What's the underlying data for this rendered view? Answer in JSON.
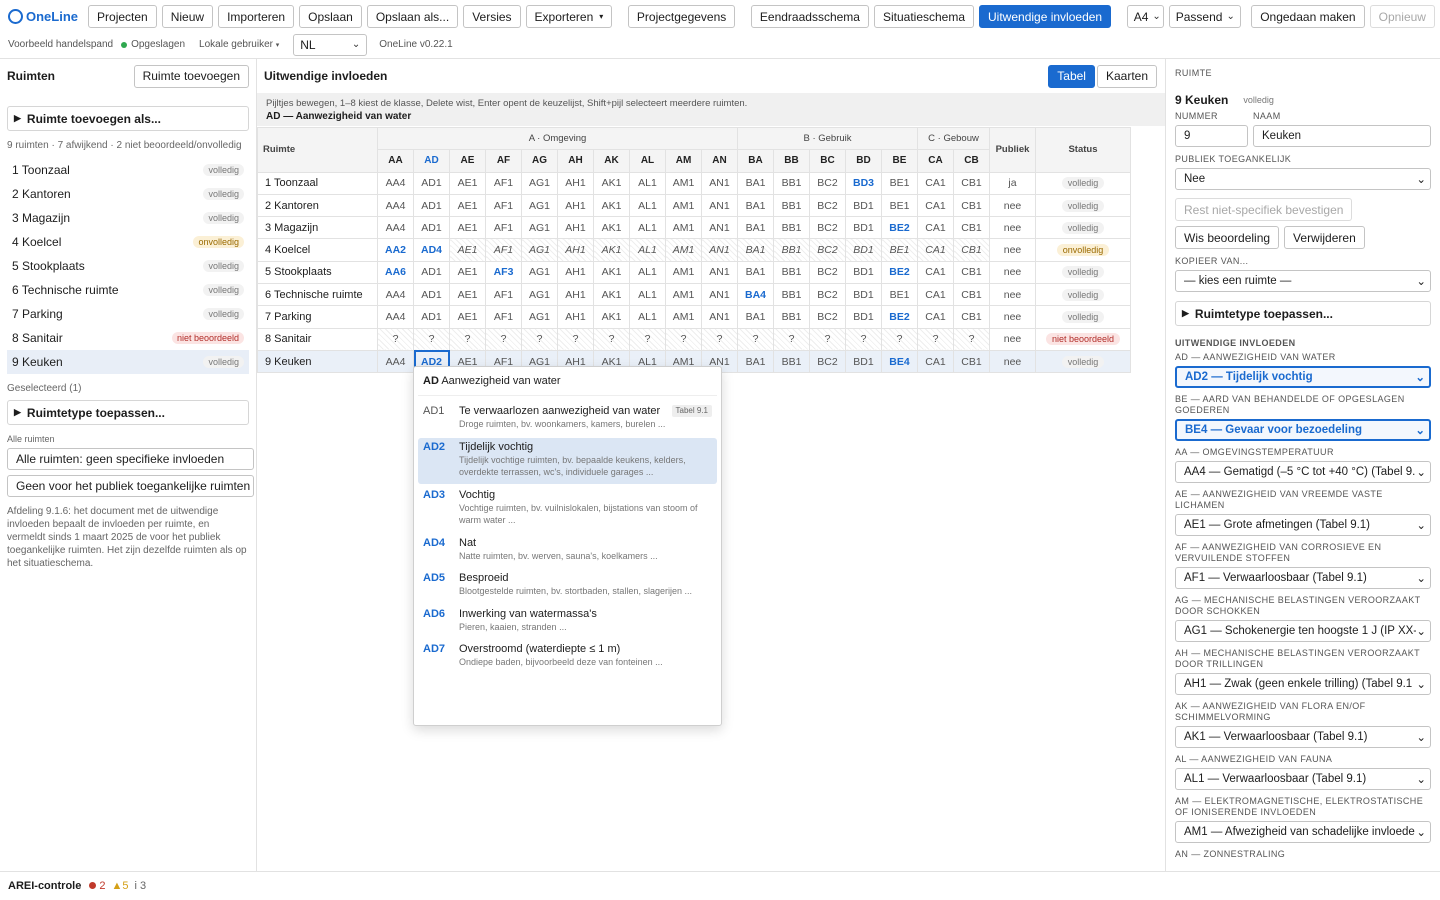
{
  "toolbar": {
    "logo": "OneLine",
    "buttons": [
      "Projecten",
      "Nieuw",
      "Importeren",
      "Opslaan",
      "Opslaan als...",
      "Versies"
    ],
    "export": "Exporteren",
    "project_data": "Projectgegevens",
    "views": [
      "Eendraadsschema",
      "Situatieschema",
      "Uitwendige invloeden"
    ],
    "paper": "A4",
    "fit": "Passend",
    "undo": "Ongedaan maken",
    "redo": "Opnieuw"
  },
  "subbar": {
    "project": "Voorbeeld handelspand",
    "saved": "Opgeslagen",
    "user": "Lokale gebruiker",
    "lang": "NL",
    "version": "OneLine v0.22.1"
  },
  "left": {
    "title": "Ruimten",
    "add_room": "Ruimte toevoegen",
    "add_as": "Ruimte toevoegen als...",
    "summary": "9 ruimten · 7 afwijkend · 2 niet beoordeeld/onvolledig",
    "rooms": [
      {
        "name": "1 Toonzaal",
        "status": "volledig"
      },
      {
        "name": "2 Kantoren",
        "status": "volledig"
      },
      {
        "name": "3 Magazijn",
        "status": "volledig"
      },
      {
        "name": "4 Koelcel",
        "status": "onvolledig"
      },
      {
        "name": "5 Stookplaats",
        "status": "volledig"
      },
      {
        "name": "6 Technische ruimte",
        "status": "volledig"
      },
      {
        "name": "7 Parking",
        "status": "volledig"
      },
      {
        "name": "8 Sanitair",
        "status": "niet beoordeeld"
      },
      {
        "name": "9 Keuken",
        "status": "volledig"
      }
    ],
    "selected_label": "Geselecteerd (1)",
    "apply_type": "Ruimtetype toepassen...",
    "all_rooms_label": "Alle ruimten",
    "all_rooms_btn1": "Alle ruimten: geen specifieke invloeden",
    "all_rooms_btn2": "Geen voor het publiek toegankelijke ruimten",
    "note": "Afdeling 9.1.6: het document met de uitwendige invloeden bepaalt de invloeden per ruimte, en vermeldt sinds 1 maart 2025 de voor het publiek toegankelijke ruimten. Het zijn dezelfde ruimten als op het situatieschema."
  },
  "mid": {
    "title": "Uitwendige invloeden",
    "toggle": [
      "Tabel",
      "Kaarten"
    ],
    "hint": "Pijltjes bewegen, 1–8 kiest de klasse, Delete wist, Enter opent de keuzelijst, Shift+pijl selecteert meerdere ruimten.",
    "hint_cell": "AD — Aanwezigheid van water",
    "col_room": "Ruimte",
    "groups": [
      "A · Omgeving",
      "B · Gebruik",
      "C · Gebouw"
    ],
    "col_public": "Publiek",
    "col_status": "Status",
    "codes": [
      "AA",
      "AD",
      "AE",
      "AF",
      "AG",
      "AH",
      "AK",
      "AL",
      "AM",
      "AN",
      "BA",
      "BB",
      "BC",
      "BD",
      "BE",
      "CA",
      "CB"
    ],
    "rows": [
      {
        "name": "1 Toonzaal",
        "cells": [
          "AA4",
          "AD1",
          "AE1",
          "AF1",
          "AG1",
          "AH1",
          "AK1",
          "AL1",
          "AM1",
          "AN1",
          "BA1",
          "BB1",
          "BC2",
          "BD3",
          "BE1",
          "CA1",
          "CB1"
        ],
        "public": "ja",
        "status": "volledig"
      },
      {
        "name": "2 Kantoren",
        "cells": [
          "AA4",
          "AD1",
          "AE1",
          "AF1",
          "AG1",
          "AH1",
          "AK1",
          "AL1",
          "AM1",
          "AN1",
          "BA1",
          "BB1",
          "BC2",
          "BD1",
          "BE1",
          "CA1",
          "CB1"
        ],
        "public": "nee",
        "status": "volledig"
      },
      {
        "name": "3 Magazijn",
        "cells": [
          "AA4",
          "AD1",
          "AE1",
          "AF1",
          "AG1",
          "AH1",
          "AK1",
          "AL1",
          "AM1",
          "AN1",
          "BA1",
          "BB1",
          "BC2",
          "BD1",
          "BE2",
          "CA1",
          "CB1"
        ],
        "public": "nee",
        "status": "volledig"
      },
      {
        "name": "4 Koelcel",
        "cells": [
          "AA2",
          "AD4",
          "AE1",
          "AF1",
          "AG1",
          "AH1",
          "AK1",
          "AL1",
          "AM1",
          "AN1",
          "BA1",
          "BB1",
          "BC2",
          "BD1",
          "BE1",
          "CA1",
          "CB1"
        ],
        "public": "nee",
        "status": "onvolledig"
      },
      {
        "name": "5 Stookplaats",
        "cells": [
          "AA6",
          "AD1",
          "AE1",
          "AF3",
          "AG1",
          "AH1",
          "AK1",
          "AL1",
          "AM1",
          "AN1",
          "BA1",
          "BB1",
          "BC2",
          "BD1",
          "BE2",
          "CA1",
          "CB1"
        ],
        "public": "nee",
        "status": "volledig"
      },
      {
        "name": "6 Technische ruimte",
        "cells": [
          "AA4",
          "AD1",
          "AE1",
          "AF1",
          "AG1",
          "AH1",
          "AK1",
          "AL1",
          "AM1",
          "AN1",
          "BA4",
          "BB1",
          "BC2",
          "BD1",
          "BE1",
          "CA1",
          "CB1"
        ],
        "public": "nee",
        "status": "volledig"
      },
      {
        "name": "7 Parking",
        "cells": [
          "AA4",
          "AD1",
          "AE1",
          "AF1",
          "AG1",
          "AH1",
          "AK1",
          "AL1",
          "AM1",
          "AN1",
          "BA1",
          "BB1",
          "BC2",
          "BD1",
          "BE2",
          "CA1",
          "CB1"
        ],
        "public": "nee",
        "status": "volledig"
      },
      {
        "name": "8 Sanitair",
        "cells": [
          "?",
          "?",
          "?",
          "?",
          "?",
          "?",
          "?",
          "?",
          "?",
          "?",
          "?",
          "?",
          "?",
          "?",
          "?",
          "?",
          "?"
        ],
        "public": "nee",
        "status": "niet beoordeeld"
      },
      {
        "name": "9 Keuken",
        "cells": [
          "AA4",
          "AD2",
          "AE1",
          "AF1",
          "AG1",
          "AH1",
          "AK1",
          "AL1",
          "AM1",
          "AN1",
          "BA1",
          "BB1",
          "BC2",
          "BD1",
          "BE4",
          "CA1",
          "CB1"
        ],
        "public": "nee",
        "status": "volledig"
      }
    ]
  },
  "popup": {
    "code": "AD",
    "title": "Aanwezigheid van water",
    "options": [
      {
        "code": "AD1",
        "title": "Te verwaarlozen aanwezigheid van water",
        "desc": "Droge ruimten, bv. woonkamers, kamers, burelen ...",
        "tag": "Tabel 9.1"
      },
      {
        "code": "AD2",
        "title": "Tijdelijk vochtig",
        "desc": "Tijdelijk vochtige ruimten, bv. bepaalde keukens, kelders, overdekte terrassen, wc's, individuele garages ..."
      },
      {
        "code": "AD3",
        "title": "Vochtig",
        "desc": "Vochtige ruimten, bv. vuilnislokalen, bijstations van stoom of warm water ..."
      },
      {
        "code": "AD4",
        "title": "Nat",
        "desc": "Natte ruimten, bv. werven, sauna's, koelkamers ..."
      },
      {
        "code": "AD5",
        "title": "Besproeid",
        "desc": "Blootgestelde ruimten, bv. stortbaden, stallen, slagerijen ..."
      },
      {
        "code": "AD6",
        "title": "Inwerking van watermassa's",
        "desc": "Pieren, kaaien, stranden ..."
      },
      {
        "code": "AD7",
        "title": "Overstroomd (waterdiepte ≤ 1 m)",
        "desc": "Ondiepe baden, bijvoorbeeld deze van fonteinen ..."
      }
    ]
  },
  "right": {
    "section": "RUIMTE",
    "room_title": "9 Keuken",
    "room_status": "volledig",
    "number_label": "NUMMER",
    "name_label": "NAAM",
    "number": "9",
    "name": "Keuken",
    "public_label": "PUBLIEK TOEGANKELIJK",
    "public_value": "Nee",
    "rest_btn": "Rest niet-specifiek bevestigen",
    "clear_btn": "Wis beoordeling",
    "delete_btn": "Verwijderen",
    "copy_label": "KOPIEER VAN...",
    "copy_value": "— kies een ruimte —",
    "apply_type": "Ruimtetype toepassen...",
    "influences_title": "UITWENDIGE INVLOEDEN",
    "fields": [
      {
        "label": "AD — AANWEZIGHEID VAN WATER",
        "value": "AD2 — Tijdelijk vochtig",
        "highlight": true
      },
      {
        "label": "BE — AARD VAN BEHANDELDE OF OPGESLAGEN GOEDEREN",
        "value": "BE4 — Gevaar voor bezoedeling",
        "highlight": true
      },
      {
        "label": "AA — OMGEVINGSTEMPERATUUR",
        "value": "AA4 — Gematigd (–5 °C tot +40 °C) (Tabel 9.1)",
        "highlight": false
      },
      {
        "label": "AE — AANWEZIGHEID VAN VREEMDE VASTE LICHAMEN",
        "value": "AE1 — Grote afmetingen (Tabel 9.1)",
        "highlight": false
      },
      {
        "label": "AF — AANWEZIGHEID VAN CORROSIEVE EN VERVUILENDE STOFFEN",
        "value": "AF1 — Verwaarloosbaar (Tabel 9.1)",
        "highlight": false
      },
      {
        "label": "AG — MECHANISCHE BELASTINGEN VEROORZAAKT DOOR SCHOKKEN",
        "value": "AG1 — Schokenergie ten hoogste 1 J (IP XX-",
        "highlight": false
      },
      {
        "label": "AH — MECHANISCHE BELASTINGEN VEROORZAAKT DOOR TRILLINGEN",
        "value": "AH1 — Zwak (geen enkele trilling) (Tabel 9.1",
        "highlight": false
      },
      {
        "label": "AK — AANWEZIGHEID VAN FLORA EN/OF SCHIMMELVORMING",
        "value": "AK1 — Verwaarloosbaar (Tabel 9.1)",
        "highlight": false
      },
      {
        "label": "AL — AANWEZIGHEID VAN FAUNA",
        "value": "AL1 — Verwaarloosbaar (Tabel 9.1)",
        "highlight": false
      },
      {
        "label": "AM — ELEKTROMAGNETISCHE, ELEKTROSTATISCHE OF IONISERENDE INVLOEDEN",
        "value": "AM1 — Afwezigheid van schadelijke invloede",
        "highlight": false
      }
    ],
    "last_label": "AN — ZONNESTRALING"
  },
  "footer": {
    "title": "AREI-controle",
    "errors": "2",
    "warnings": "5",
    "info": "3"
  }
}
